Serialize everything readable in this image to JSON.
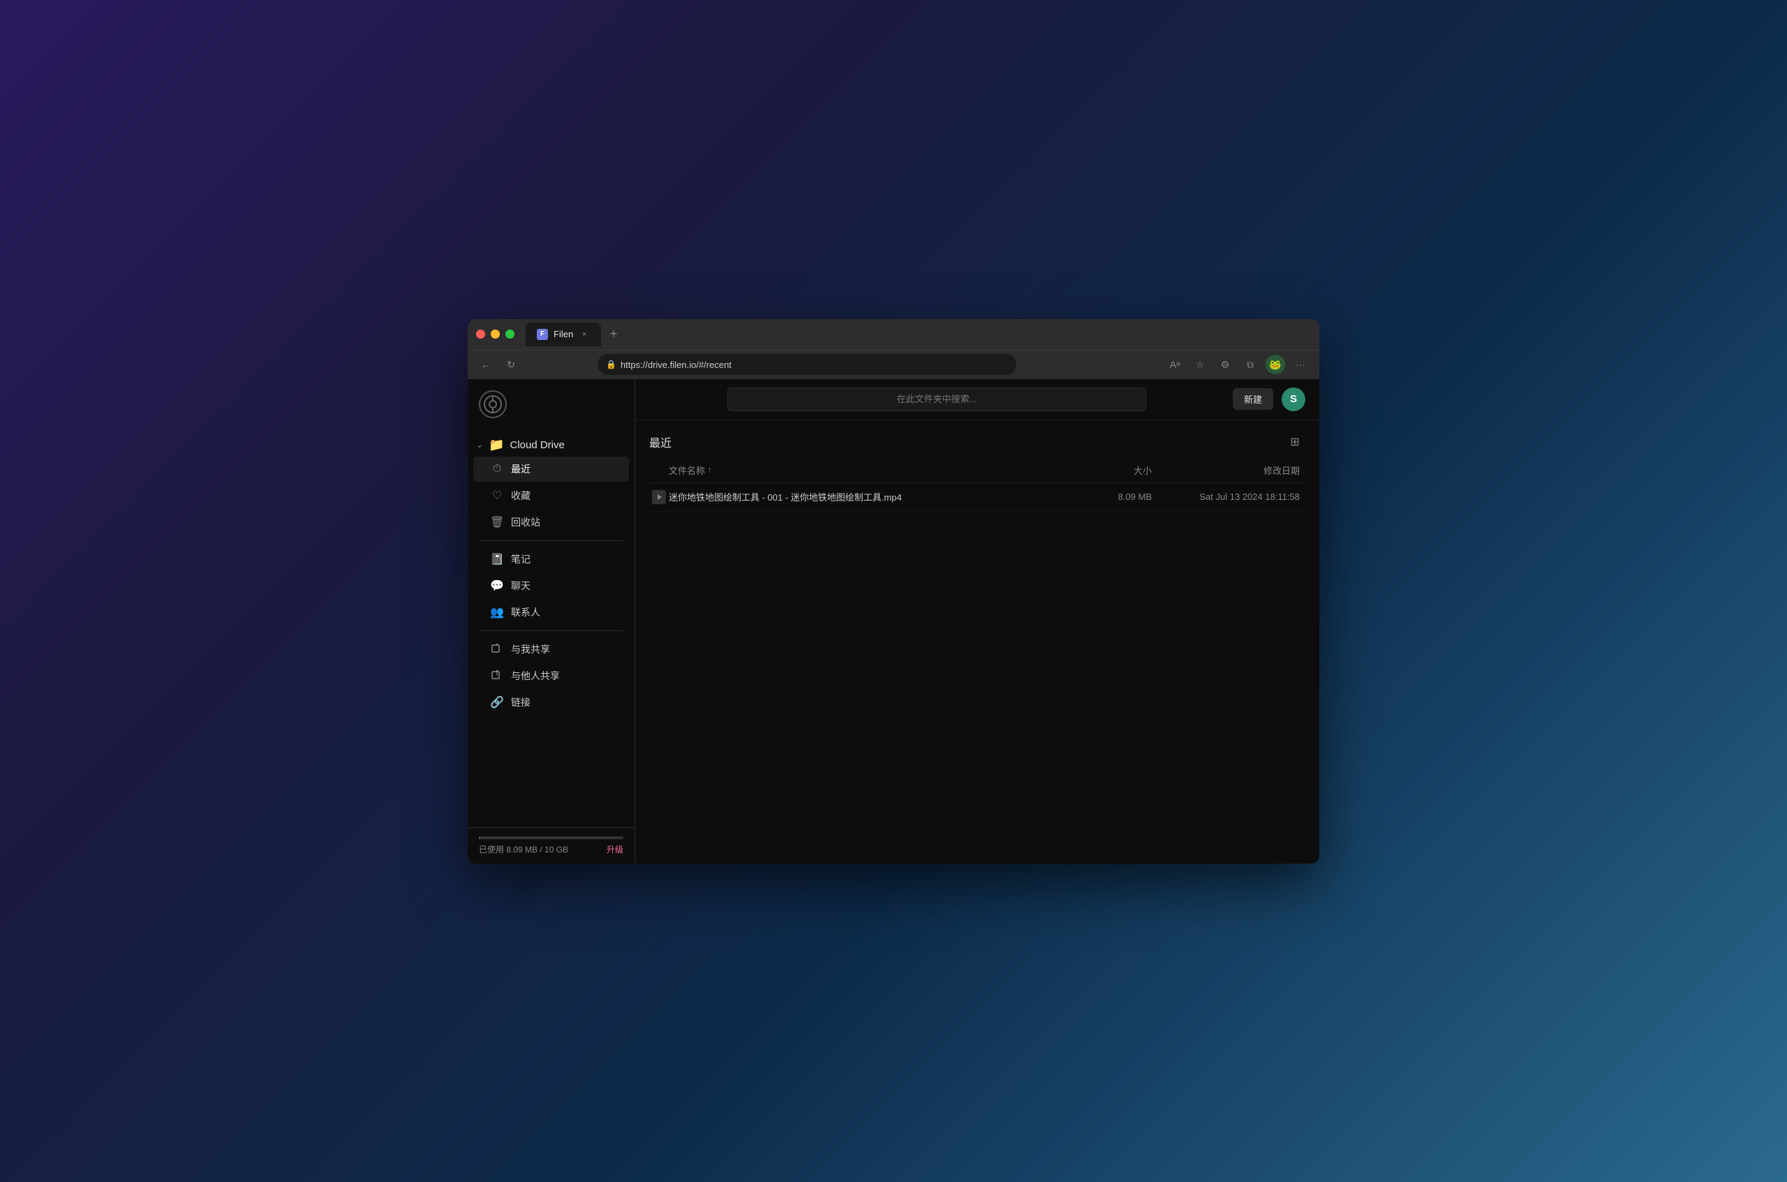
{
  "browser": {
    "tab_title": "Filen",
    "tab_close": "×",
    "new_tab": "+",
    "url_lock": "🔒",
    "url_text": "https://drive.filen.io/#/recent",
    "url_domain_start": "https://",
    "url_domain": "drive.filen.io",
    "url_path": "/#/recent",
    "back_icon": "←",
    "reload_icon": "↻",
    "reader_mode_icon": "A↕",
    "star_icon": "☆",
    "extension_icon": "⚙",
    "split_icon": "⊡",
    "more_icon": "···"
  },
  "sidebar": {
    "logo_symbol": "⊕",
    "cloud_drive_chevron": "⌄",
    "cloud_drive_folder": "📁",
    "cloud_drive_label": "Cloud Drive",
    "nav_items": [
      {
        "id": "recent",
        "icon": "⏱",
        "label": "最近",
        "active": true
      },
      {
        "id": "favorites",
        "icon": "♡",
        "label": "收藏",
        "active": false
      },
      {
        "id": "trash",
        "icon": "🗑",
        "label": "回收站",
        "active": false
      }
    ],
    "nav_items2": [
      {
        "id": "notes",
        "icon": "📓",
        "label": "笔记",
        "active": false
      },
      {
        "id": "chat",
        "icon": "💬",
        "label": "聊天",
        "active": false
      },
      {
        "id": "contacts",
        "icon": "👥",
        "label": "联系人",
        "active": false
      }
    ],
    "nav_items3": [
      {
        "id": "shared-with-me",
        "icon": "📂",
        "label": "与我共享",
        "active": false
      },
      {
        "id": "shared-with-others",
        "icon": "📂",
        "label": "与他人共享",
        "active": false
      },
      {
        "id": "links",
        "icon": "🔗",
        "label": "链接",
        "active": false
      }
    ],
    "storage_text": "已使用 8.09 MB / 10 GB",
    "upgrade_label": "升级"
  },
  "main": {
    "search_placeholder": "在此文件夹中搜索...",
    "new_button_label": "新建",
    "user_avatar_letter": "S",
    "section_title": "最近",
    "view_toggle_icon": "⊞",
    "columns": {
      "name": "文件名称",
      "sort_arrow": "↑",
      "size": "大小",
      "date": "修改日期"
    },
    "files": [
      {
        "name": "迷你地铁地图绘制工具 - 001 - 迷你地铁地图绘制工具.mp4",
        "size": "8.09 MB",
        "date": "Sat Jul 13 2024 18:11:58",
        "icon": "▶"
      }
    ]
  }
}
